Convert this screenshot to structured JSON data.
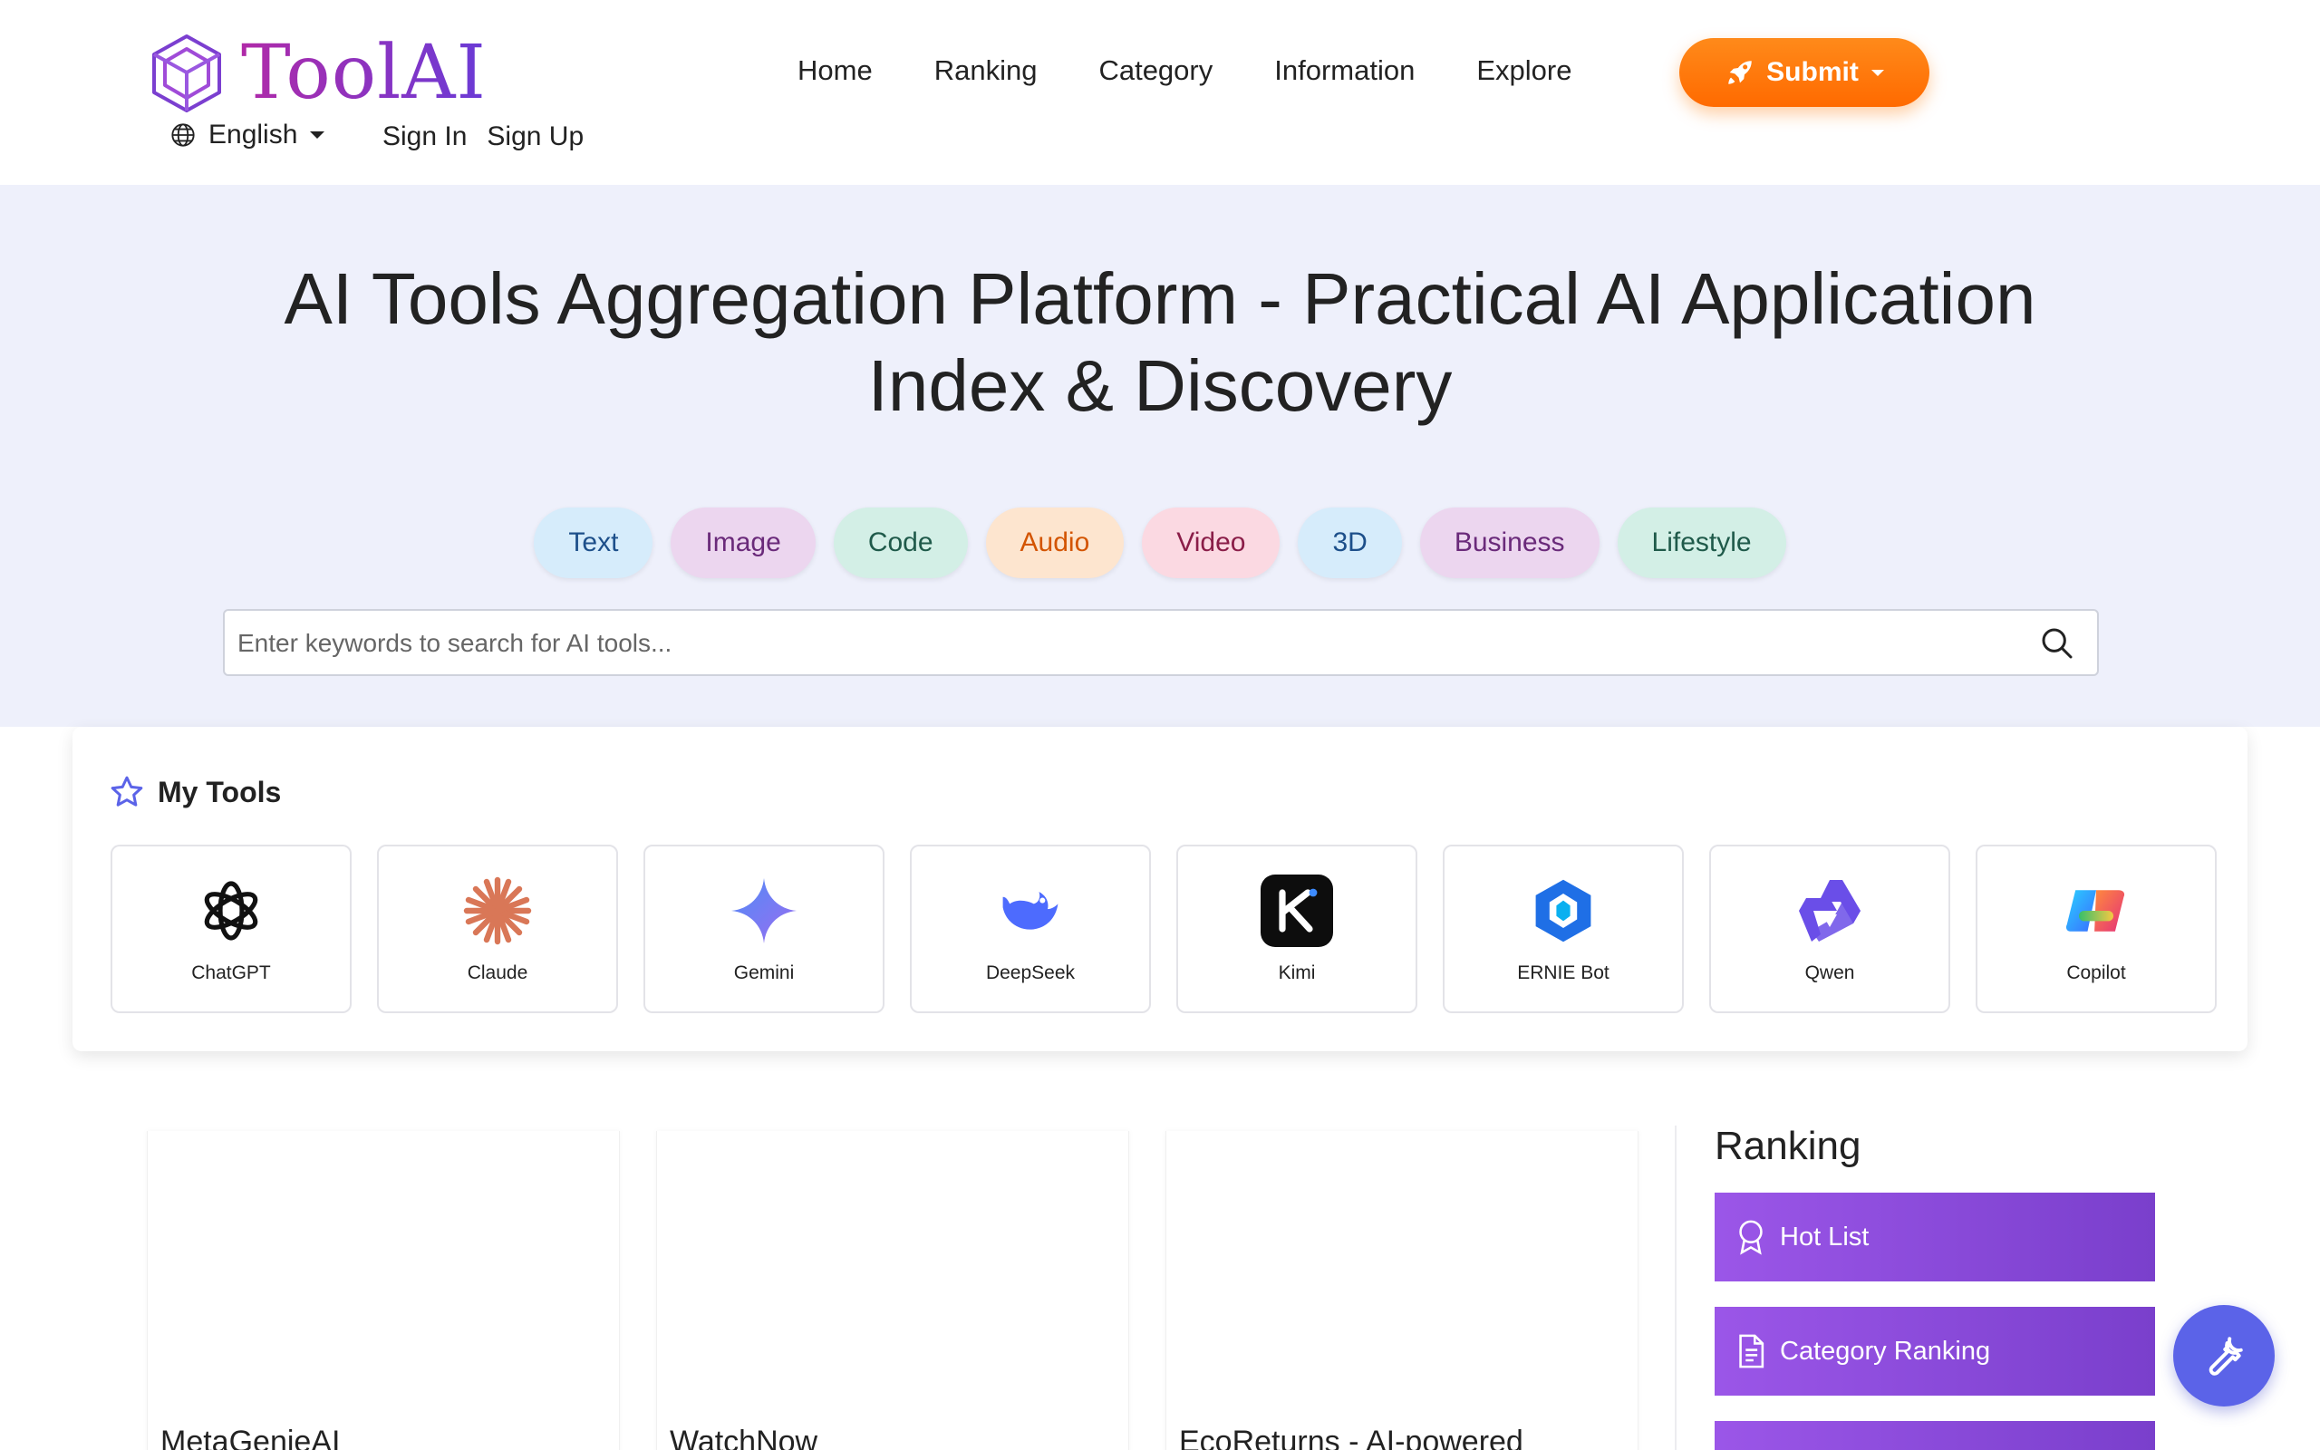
{
  "app": {
    "logo_text": "ToolAI"
  },
  "header": {
    "language": "English",
    "sign_in": "Sign In",
    "sign_up": "Sign Up",
    "nav": [
      "Home",
      "Ranking",
      "Category",
      "Information",
      "Explore"
    ],
    "submit_label": "Submit"
  },
  "hero": {
    "title_line1": "AI Tools Aggregation Platform - Practical AI Application",
    "title_line2": "Index & Discovery",
    "chips": [
      {
        "label": "Text",
        "bg": "#d6ecfb",
        "fg": "#1d4f8a"
      },
      {
        "label": "Image",
        "bg": "#ecd6ef",
        "fg": "#6a2a7a"
      },
      {
        "label": "Code",
        "bg": "#d3efe6",
        "fg": "#1f5a4a"
      },
      {
        "label": "Audio",
        "bg": "#fde5cf",
        "fg": "#d35400"
      },
      {
        "label": "Video",
        "bg": "#fbd9e2",
        "fg": "#8a1d48"
      },
      {
        "label": "3D",
        "bg": "#d6ecfb",
        "fg": "#1d4f8a"
      },
      {
        "label": "Business",
        "bg": "#ecd6ef",
        "fg": "#6a2a7a"
      },
      {
        "label": "Lifestyle",
        "bg": "#d3efe6",
        "fg": "#1f5a4a"
      }
    ],
    "search_placeholder": "Enter keywords to search for AI tools..."
  },
  "my_tools": {
    "heading": "My Tools",
    "items": [
      {
        "name": "ChatGPT",
        "icon": "openai-icon"
      },
      {
        "name": "Claude",
        "icon": "claude-icon"
      },
      {
        "name": "Gemini",
        "icon": "gemini-icon"
      },
      {
        "name": "DeepSeek",
        "icon": "deepseek-icon"
      },
      {
        "name": "Kimi",
        "icon": "kimi-icon"
      },
      {
        "name": "ERNIE Bot",
        "icon": "ernie-icon"
      },
      {
        "name": "Qwen",
        "icon": "qwen-icon"
      },
      {
        "name": "Copilot",
        "icon": "copilot-icon"
      }
    ]
  },
  "listing": {
    "cards": [
      "MetaGenieAI",
      "WatchNow",
      "EcoReturns - AI-powered"
    ]
  },
  "ranking": {
    "title": "Ranking",
    "items": [
      "Hot List",
      "Category Ranking",
      ""
    ]
  },
  "colors": {
    "accent": "#ff7a00",
    "brand": "#7a3fcc",
    "fab": "#5b63e8"
  }
}
